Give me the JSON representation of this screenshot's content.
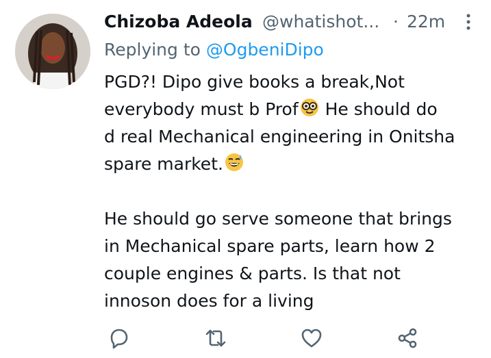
{
  "tweet": {
    "author_name": "Chizoba Adeola",
    "handle": "@whatishot...",
    "separator": "·",
    "time": "22m",
    "replying_prefix": "Replying to ",
    "replying_handle": "@OgbeniDipo",
    "paragraph1": {
      "line1": "PGD?! Dipo give books a break,Not",
      "line2_a": "everybody must b Prof",
      "line2_b": " He should do",
      "line3": "d real Mechanical engineering in Onitsha",
      "line4": "spare market."
    },
    "paragraph2": {
      "line1": "He should go serve someone that brings",
      "line2": "in Mechanical spare parts, learn how 2",
      "line3": "couple engines & parts. Is that not",
      "line4": "innoson does for a living"
    },
    "emojis": [
      "nerd-face-emoji",
      "grinning-sweat-emoji"
    ]
  },
  "actions": [
    "reply-icon",
    "retweet-icon",
    "like-icon",
    "share-icon"
  ],
  "colors": {
    "text": "#0f1419",
    "secondary": "#536471",
    "accent": "#1d9bf0"
  }
}
